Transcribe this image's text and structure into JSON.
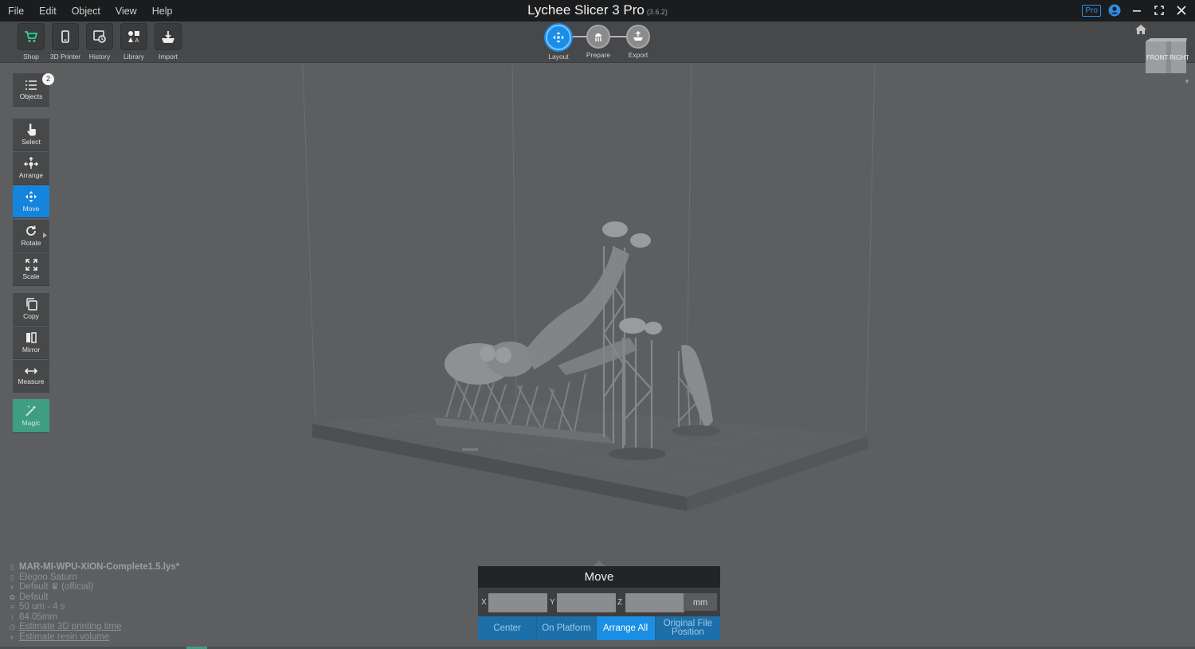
{
  "menu": [
    "File",
    "Edit",
    "Object",
    "View",
    "Help"
  ],
  "app": {
    "title": "Lychee Slicer 3 Pro",
    "version": "(3.6.2)",
    "pro_badge": "Pro"
  },
  "toolbar": {
    "items": [
      "Shop",
      "3D Printer",
      "History",
      "Library",
      "Import"
    ]
  },
  "workflow": {
    "steps": [
      "Layout",
      "Prepare",
      "Export"
    ],
    "active": "Layout"
  },
  "tools": {
    "objects_label": "Objects",
    "objects_count": "2",
    "select": "Select",
    "arrange": "Arrange",
    "move": "Move",
    "rotate": "Rotate",
    "scale": "Scale",
    "copy": "Copy",
    "mirror": "Mirror",
    "measure": "Measure",
    "magic": "Magic"
  },
  "viewcube": {
    "front": "FRONT",
    "right": "RIGHT"
  },
  "info": {
    "filename": "MAR-MI-WPU-XION-Complete1.5.lys*",
    "printer": "Elegoo Saturn",
    "resin": "Default",
    "resin_official": "(official)",
    "profile": "Default",
    "layer": "50 um - 4 s",
    "height": "84.05mm",
    "estimate_time": "Estimate 3D printing time",
    "estimate_volume": "Estimate resin volume"
  },
  "move_panel": {
    "title": "Move",
    "axes": [
      "X",
      "Y",
      "Z"
    ],
    "unit": "mm",
    "actions": [
      "Center",
      "On Platform",
      "Arrange All",
      "Original File Position"
    ],
    "active_action": "Arrange All"
  },
  "colors": {
    "accent": "#1a8ee6",
    "magic": "#3f9e81",
    "background": "#5d5e60",
    "titlebar": "#1b1c1e"
  }
}
